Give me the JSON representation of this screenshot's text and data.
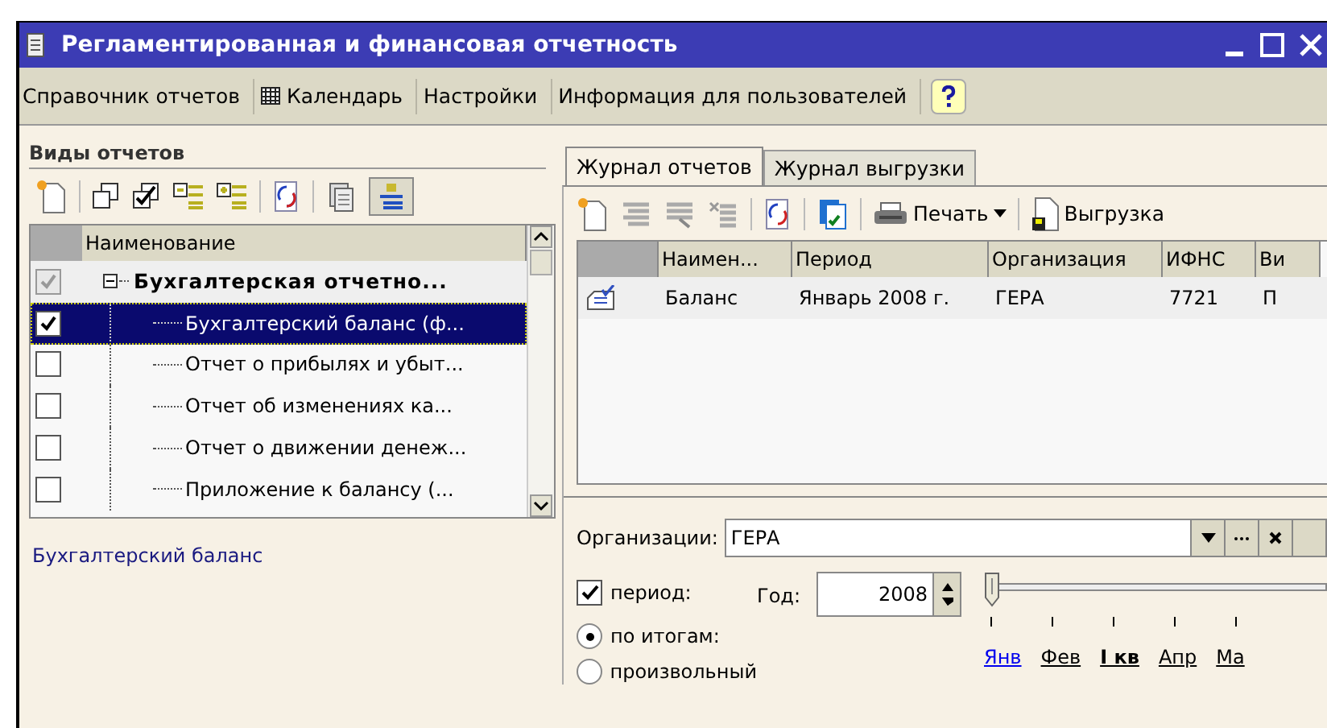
{
  "window": {
    "title": "Регламентированная и финансовая отчетность"
  },
  "menu": [
    {
      "label": "Справочник отчетов",
      "kind": "text"
    },
    {
      "label": "Календарь",
      "kind": "calendar"
    },
    {
      "label": "Настройки",
      "kind": "text"
    },
    {
      "label": "Информация для пользователей",
      "kind": "text"
    },
    {
      "kind": "help"
    }
  ],
  "report_types": {
    "title": "Виды отчетов",
    "column": "Наименование",
    "group": {
      "label": "Бухгалтерская отчетно...",
      "checked": true,
      "expanded": true,
      "children": [
        {
          "label": "Бухгалтерский баланс (ф...",
          "checked": true,
          "selected": true
        },
        {
          "label": "Отчет о прибылях и убыт...",
          "checked": false,
          "selected": false
        },
        {
          "label": "Отчет об изменениях ка...",
          "checked": false,
          "selected": false
        },
        {
          "label": "Отчет о движении денеж...",
          "checked": false,
          "selected": false
        },
        {
          "label": "Приложение к балансу (...",
          "checked": false,
          "selected": false
        }
      ]
    },
    "description": "Бухгалтерский баланс"
  },
  "tabs": [
    {
      "label": "Журнал отчетов",
      "selected": true
    },
    {
      "label": "Журнал выгрузки",
      "selected": false
    }
  ],
  "journal_toolbar": {
    "print": "Печать",
    "export": "Выгрузка"
  },
  "table": {
    "columns": [
      "Наимен...",
      "Период",
      "Организация",
      "ИФНС",
      "Ви"
    ],
    "rows": [
      [
        "Баланс",
        "Январь 2008 г.",
        "ГЕРА",
        "7721",
        "П"
      ]
    ]
  },
  "filter": {
    "organization_label": "Организации:",
    "organization": "ГЕРА",
    "period": {
      "label": "период:",
      "checked": true
    },
    "year_label": "Год:",
    "year": "2008",
    "modes": [
      {
        "label": "по итогам:",
        "selected": true
      },
      {
        "label": "произвольный",
        "selected": false
      }
    ],
    "slider": {
      "level": 0
    },
    "months": [
      {
        "label": "Янв",
        "kind": "month",
        "selected": true
      },
      {
        "label": "Фев",
        "kind": "month",
        "selected": false
      },
      {
        "label": "I кв",
        "kind": "quarter",
        "selected": false
      },
      {
        "label": "Апр",
        "kind": "month",
        "selected": false
      },
      {
        "label": "Ма",
        "kind": "month",
        "selected": false
      }
    ]
  }
}
